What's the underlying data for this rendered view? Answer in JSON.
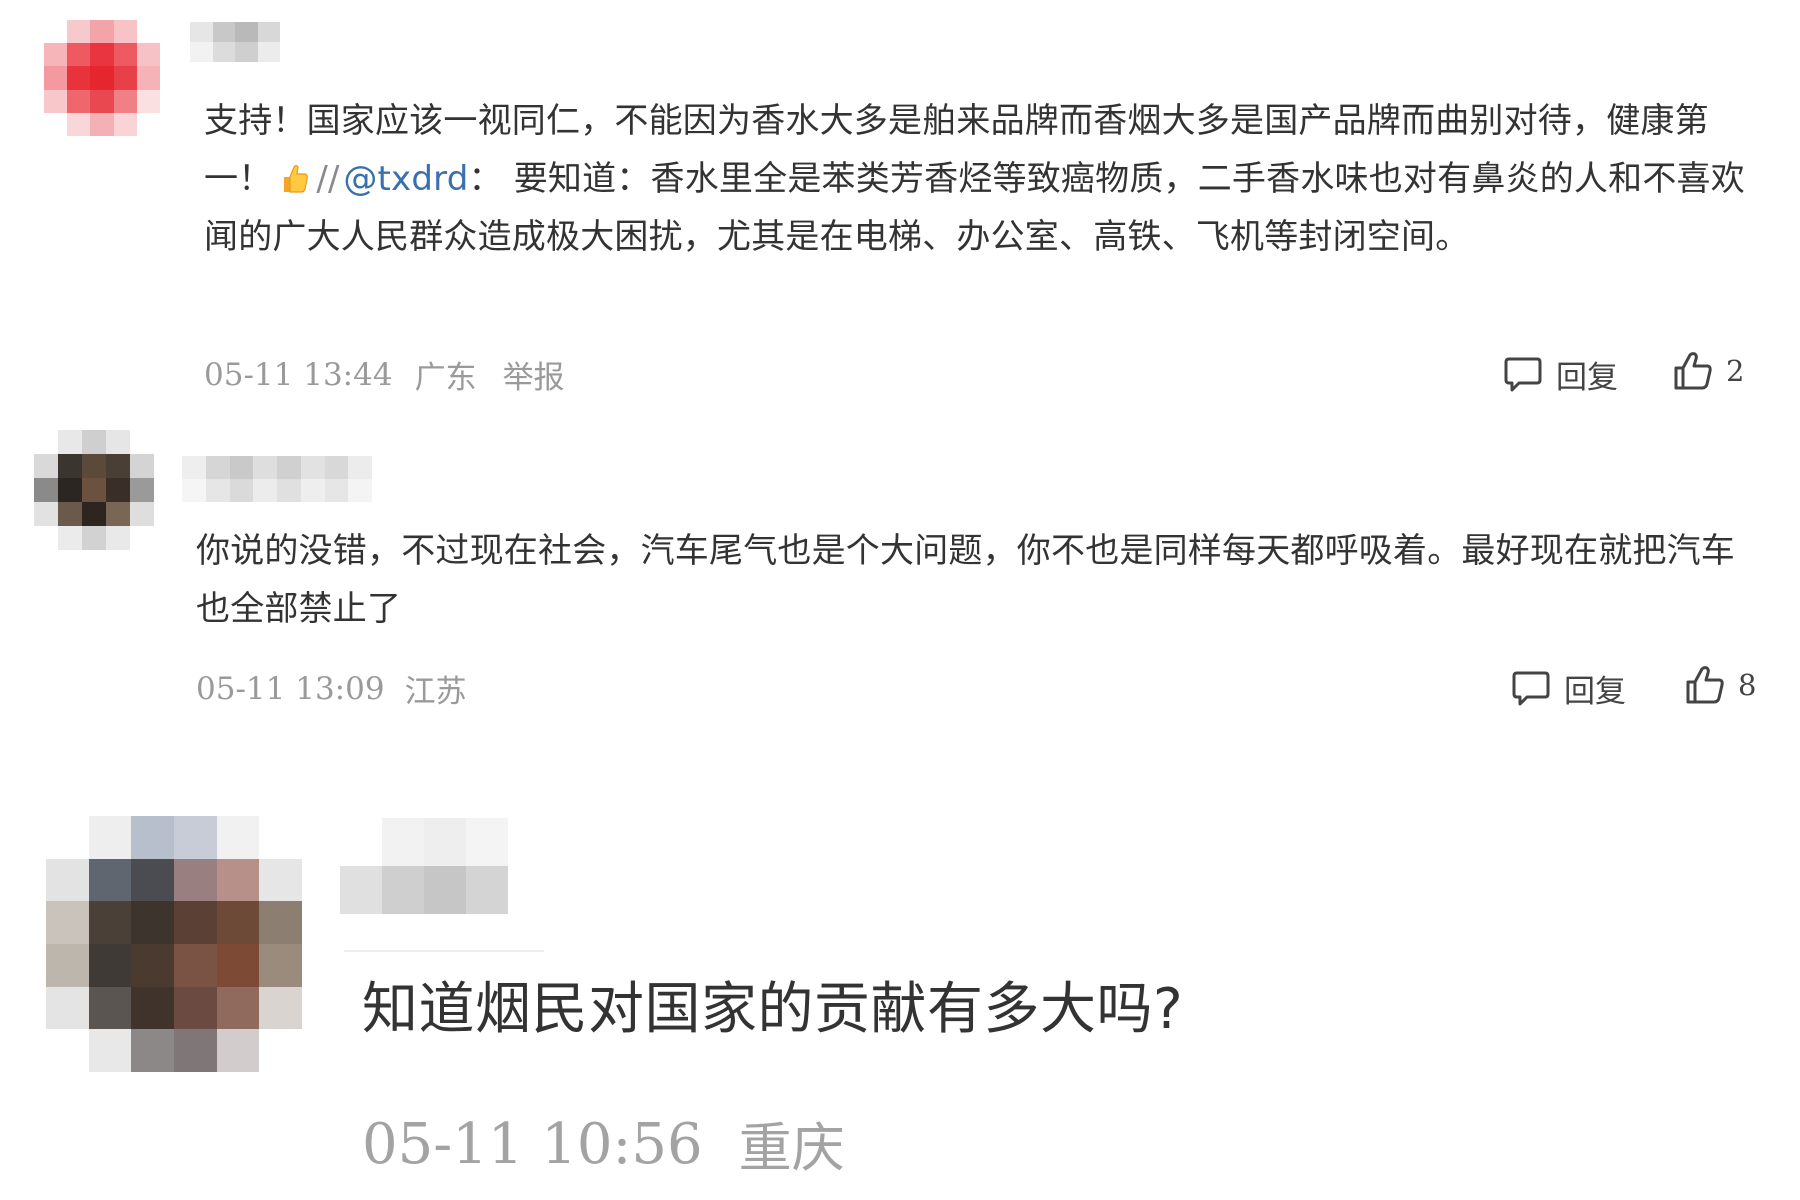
{
  "comments": [
    {
      "text_lead": "支持！国家应该一视同仁，不能因为香水大多是舶来品牌而香烟大多是国产品牌而曲别对待，健康第一！",
      "emoji": "thumbs-up-emoji",
      "repost_sep": "//",
      "mention": "@txdrd",
      "text_tail": "： 要知道：香水里全是苯类芳香烃等致癌物质，二手香水味也对有鼻炎的人和不喜欢闻的广大人民群众造成极大困扰，尤其是在电梯、办公室、高铁、飞机等封闭空间。",
      "time": "05-11 13:44",
      "location": "广东",
      "report": "举报",
      "reply_label": "回复",
      "likes": "2"
    },
    {
      "text": "你说的没错，不过现在社会，汽车尾气也是个大问题，你不也是同样每天都呼吸着。最好现在就把汽车也全部禁止了",
      "time": "05-11 13:09",
      "location": "江苏",
      "reply_label": "回复",
      "likes": "8"
    },
    {
      "text": "知道烟民对国家的贡献有多大吗?",
      "time": "05-11 10:56",
      "location": "重庆"
    }
  ],
  "colors": {
    "mention": "#3a6fb0",
    "meta": "#9a9a9a"
  }
}
